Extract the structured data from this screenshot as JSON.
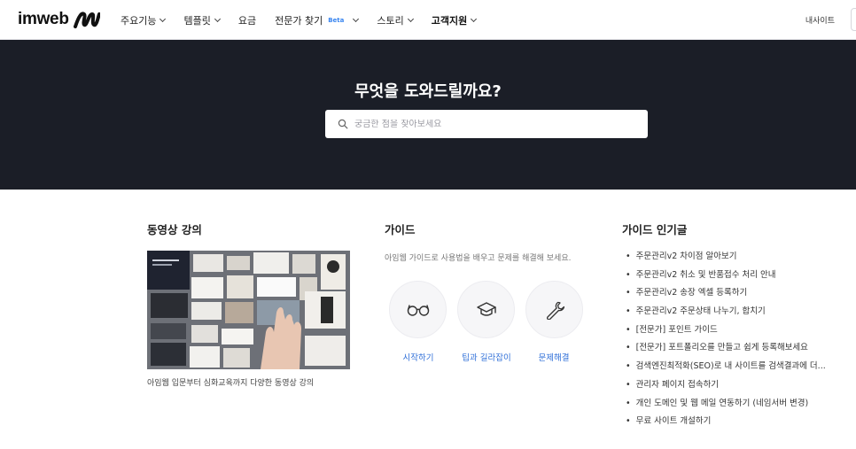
{
  "header": {
    "logo_text": "imweb",
    "nav": [
      {
        "label": "주요기능",
        "chevron": true
      },
      {
        "label": "템플릿",
        "chevron": true
      },
      {
        "label": "요금",
        "chevron": false
      },
      {
        "label": "전문가 찾기",
        "badge": "Beta",
        "chevron": true
      },
      {
        "label": "스토리",
        "chevron": true
      },
      {
        "label": "고객지원",
        "chevron": true,
        "active": true
      }
    ],
    "my_site": "내사이트"
  },
  "hero": {
    "title": "무엇을 도와드릴까요?",
    "search_placeholder": "궁금한 점을 찾아보세요"
  },
  "video": {
    "title": "동영상 강의",
    "caption": "아임웹 입문부터 심화교육까지 다양한 동영상 강의"
  },
  "guide": {
    "title": "가이드",
    "description": "아임웹 가이드로 사용법을 배우고 문제를 해결해 보세요.",
    "items": [
      {
        "label": "시작하기",
        "icon": "glasses-icon"
      },
      {
        "label": "팁과 길라잡이",
        "icon": "graduation-cap-icon"
      },
      {
        "label": "문제해결",
        "icon": "wrench-icon"
      }
    ]
  },
  "popular": {
    "title": "가이드 인기글",
    "items": [
      "주문관리v2 차이점 알아보기",
      "주문관리v2 취소 및 반품접수 처리 안내",
      "주문관리v2 송장 엑셀 등록하기",
      "주문관리v2 주문상태 나누기, 합치기",
      "[전문가] 포인트 가이드",
      "[전문가] 포트폴리오를 만들고 쉽게 등록해보세요",
      "검색엔진최적화(SEO)로 내 사이트를 검색결과에 더...",
      "관리자 페이지 접속하기",
      "개인 도메인 및 웹 메일 연동하기 (네임서버 변경)",
      "무료 사이트 개설하기"
    ]
  },
  "colors": {
    "hero_bg": "#1b1e27",
    "link_blue": "#2f6fd8",
    "beta_blue": "#3a86f0"
  }
}
